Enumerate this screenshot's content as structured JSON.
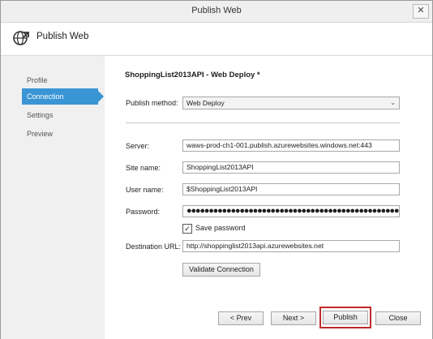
{
  "window": {
    "title": "Publish Web",
    "close_glyph": "✕"
  },
  "header": {
    "title": "Publish Web",
    "icon": "globe-arrow-icon"
  },
  "nav": {
    "items": [
      {
        "label": "Profile",
        "active": false
      },
      {
        "label": "Connection",
        "active": true
      },
      {
        "label": "Settings",
        "active": false
      },
      {
        "label": "Preview",
        "active": false
      }
    ]
  },
  "main": {
    "section_title": "ShoppingList2013API - Web Deploy *",
    "publish_method": {
      "label": "Publish method:",
      "value": "Web Deploy",
      "chevron": "⌄"
    },
    "server": {
      "label": "Server:",
      "value": "waws-prod-ch1-001.publish.azurewebsites.windows.net:443"
    },
    "site_name": {
      "label": "Site name:",
      "value": "ShoppingList2013API"
    },
    "user_name": {
      "label": "User name:",
      "value": "$ShoppingList2013API"
    },
    "password": {
      "label": "Password:",
      "value": "●●●●●●●●●●●●●●●●●●●●●●●●●●●●●●●●●●●●●●●●●●●●●●●●●●●●●●●●●●●●●●●●●●●"
    },
    "save_password": {
      "label": "Save password",
      "checked": true,
      "glyph": "✓"
    },
    "destination_url": {
      "label": "Destination URL:",
      "value": "http://shoppinglist2013api.azurewebsites.net"
    },
    "validate_label": "Validate Connection"
  },
  "footer": {
    "prev_label": "< Prev",
    "next_label": "Next >",
    "publish_label": "Publish",
    "close_label": "Close"
  },
  "colors": {
    "accent": "#3a95d5",
    "highlight": "#c02828"
  }
}
